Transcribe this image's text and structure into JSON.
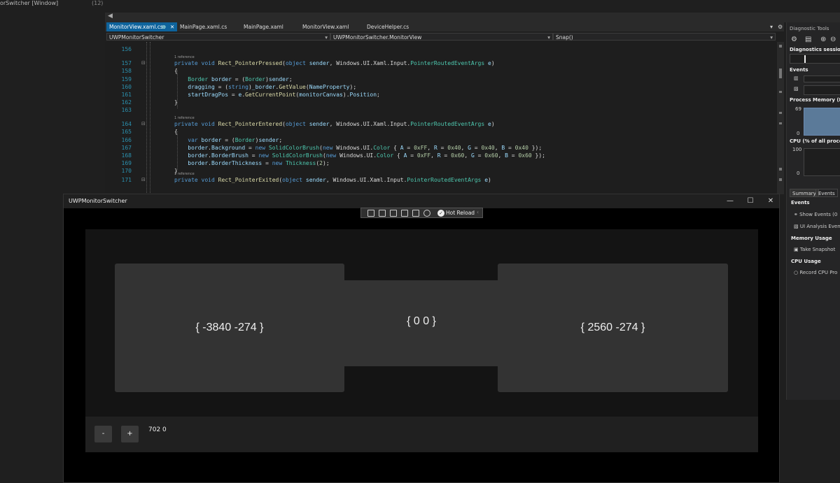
{
  "left_pane": {
    "title": "orSwitcher [Window]",
    "count": "(12)"
  },
  "tabs": [
    {
      "label": "MonitorView.xaml.cs",
      "active": true,
      "pin": "⊕",
      "close": "✕"
    },
    {
      "label": "MainPage.xaml.cs",
      "active": false
    },
    {
      "label": "MainPage.xaml",
      "active": false
    },
    {
      "label": "MonitorView.xaml",
      "active": false
    },
    {
      "label": "DeviceHelper.cs",
      "active": false
    }
  ],
  "nav": {
    "project": "UWPMonitorSwitcher",
    "class": "UWPMonitorSwitcher.MonitorView",
    "member": "Snap()"
  },
  "code_lines": [
    {
      "n": "156",
      "ref": "",
      "html": ""
    },
    {
      "n": "157",
      "ref": "1 reference",
      "html": "<span class=\"kw\">private</span> <span class=\"kw\">void</span> <span class=\"fn\">Rect_PointerPressed</span>(<span class=\"kw\">object</span> <span class=\"pm\">sender</span>, Windows.UI.Xaml.Input.<span class=\"ty\">PointerRoutedEventArgs</span> <span class=\"pm\">e</span>)"
    },
    {
      "n": "158",
      "ref": "",
      "html": "{"
    },
    {
      "n": "159",
      "ref": "",
      "html": "    <span class=\"ty\">Border</span> <span class=\"pm\">border</span> = (<span class=\"ty\">Border</span>)<span class=\"pm\">sender</span>;"
    },
    {
      "n": "160",
      "ref": "",
      "html": "    <span class=\"pm\">dragging</span> = (<span class=\"kw\">string</span>)<span class=\"pm\">_border</span>.<span class=\"fn\">GetValue</span>(<span class=\"pm\">NameProperty</span>);"
    },
    {
      "n": "161",
      "ref": "",
      "html": "    <span class=\"pm\">startDragPos</span> = <span class=\"pm\">e</span>.<span class=\"fn\">GetCurrentPoint</span>(<span class=\"pm\">monitorCanvas</span>).<span class=\"pm\">Position</span>;"
    },
    {
      "n": "162",
      "ref": "",
      "html": "}"
    },
    {
      "n": "163",
      "ref": "",
      "html": ""
    },
    {
      "n": "164",
      "ref": "1 reference",
      "html": "<span class=\"kw\">private</span> <span class=\"kw\">void</span> <span class=\"fn\">Rect_PointerEntered</span>(<span class=\"kw\">object</span> <span class=\"pm\">sender</span>, Windows.UI.Xaml.Input.<span class=\"ty\">PointerRoutedEventArgs</span> <span class=\"pm\">e</span>)"
    },
    {
      "n": "165",
      "ref": "",
      "html": "{"
    },
    {
      "n": "166",
      "ref": "",
      "html": "    <span class=\"kw\">var</span> <span class=\"pm\">border</span> = (<span class=\"ty\">Border</span>)<span class=\"pm\">sender</span>;"
    },
    {
      "n": "167",
      "ref": "",
      "html": "    <span class=\"pm\">border</span>.<span class=\"pm\">Background</span> = <span class=\"kw\">new</span> <span class=\"ty\">SolidColorBrush</span>(<span class=\"kw\">new</span> Windows.UI.<span class=\"ty\">Color</span> { <span class=\"pm\">A</span> = <span class=\"nm\">0xFF</span>, <span class=\"pm\">R</span> = <span class=\"nm\">0x40</span>, <span class=\"pm\">G</span> = <span class=\"nm\">0x40</span>, <span class=\"pm\">B</span> = <span class=\"nm\">0x40</span> });"
    },
    {
      "n": "168",
      "ref": "",
      "html": "    <span class=\"pm\">border</span>.<span class=\"pm\">BorderBrush</span> = <span class=\"kw\">new</span> <span class=\"ty\">SolidColorBrush</span>(<span class=\"kw\">new</span> Windows.UI.<span class=\"ty\">Color</span> { <span class=\"pm\">A</span> = <span class=\"nm\">0xFF</span>, <span class=\"pm\">R</span> = <span class=\"nm\">0x60</span>, <span class=\"pm\">G</span> = <span class=\"nm\">0x60</span>, <span class=\"pm\">B</span> = <span class=\"nm\">0x60</span> });"
    },
    {
      "n": "169",
      "ref": "",
      "html": "    <span class=\"pm\">border</span>.<span class=\"pm\">BorderThickness</span> = <span class=\"kw\">new</span> <span class=\"ty\">Thickness</span>(<span class=\"nm\">2</span>);"
    },
    {
      "n": "170",
      "ref": "",
      "html": "}"
    },
    {
      "n": "171",
      "ref": "1 reference",
      "html": "<span class=\"kw\">private</span> <span class=\"kw\">void</span> <span class=\"fn\">Rect_PointerExited</span>(<span class=\"kw\">object</span> <span class=\"pm\">sender</span>, Windows.UI.Xaml.Input.<span class=\"ty\">PointerRoutedEventArgs</span> <span class=\"pm\">e</span>)"
    }
  ],
  "diagnostics": {
    "title": "Diagnostic Tools",
    "session": "Diagnostics session:",
    "events": "Events",
    "process_memory": "Process Memory (M",
    "mem_max": "69",
    "mem_min": "0",
    "cpu": "CPU (% of all proce",
    "cpu_max": "100",
    "cpu_min": "0",
    "tab_summary": "Summary",
    "tab_events": "Events",
    "events_hdr": "Events",
    "show_events": "Show Events (0",
    "ui_analysis": "UI Analysis Even",
    "memory_usage": "Memory Usage",
    "take_snapshot": "Take Snapshot",
    "cpu_usage": "CPU Usage",
    "record_cpu": "Record CPU Pro"
  },
  "app": {
    "title": "UWPMonitorSwitcher",
    "minimize": "—",
    "maximize": "☐",
    "close": "✕",
    "hot_reload": "Hot Reload",
    "monitors": [
      {
        "label": "{ -3840 -274 }"
      },
      {
        "label": "{ 0 0 }"
      },
      {
        "label": "{ 2560 -274 }"
      }
    ],
    "minus": "-",
    "plus": "+",
    "offset": "702 0"
  },
  "colors": {
    "accent": "#0e639c",
    "monitor": "#333333",
    "canvas": "#141414"
  }
}
